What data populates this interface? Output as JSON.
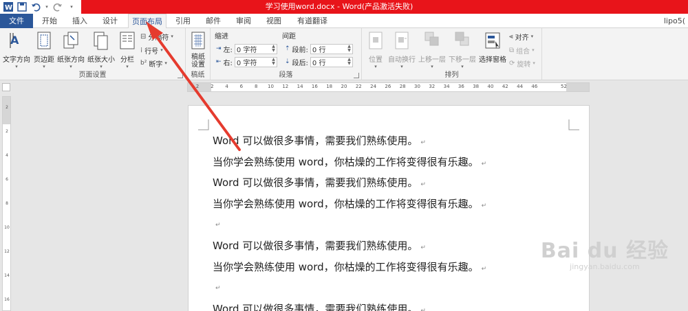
{
  "window": {
    "title": "学习使用word.docx -  Word(产品激活失败)"
  },
  "tabs": [
    {
      "label": "文件"
    },
    {
      "label": "开始"
    },
    {
      "label": "插入"
    },
    {
      "label": "设计"
    },
    {
      "label": "页面布局"
    },
    {
      "label": "引用"
    },
    {
      "label": "邮件"
    },
    {
      "label": "审阅"
    },
    {
      "label": "视图"
    },
    {
      "label": "有道翻译"
    }
  ],
  "account": {
    "name": "lipo5("
  },
  "page_setup": {
    "text_direction": "文字方向",
    "margins": "页边距",
    "orientation": "纸张方向",
    "size": "纸张大小",
    "columns": "分栏",
    "breaks": "分隔符",
    "line_numbers": "行号",
    "hyphenation": "断字",
    "group_label": "页面设置"
  },
  "draft_paper": {
    "button": "稿纸设置",
    "group_label": "稿纸"
  },
  "paragraph": {
    "indent_header": "缩进",
    "spacing_header": "间距",
    "left_label": "左:",
    "left_value": "0 字符",
    "right_label": "右:",
    "right_value": "0 字符",
    "before_label": "段前:",
    "before_value": "0 行",
    "after_label": "段后:",
    "after_value": "0 行",
    "group_label": "段落"
  },
  "arrange": {
    "position": "位置",
    "wrap_text": "自动换行",
    "bring_forward": "上移一层",
    "send_backward": "下移一层",
    "selection_pane": "选择窗格",
    "align": "对齐",
    "group": "组合",
    "rotate": "旋转",
    "group_label": "排列"
  },
  "ruler": {
    "ticks": [
      "2",
      "2",
      "4",
      "6",
      "8",
      "10",
      "12",
      "14",
      "16",
      "18",
      "20",
      "22",
      "24",
      "26",
      "28",
      "30",
      "32",
      "34",
      "36",
      "38",
      "40",
      "42",
      "44",
      "46",
      "",
      "52"
    ],
    "vticks": [
      "2",
      "",
      "2",
      "",
      "4",
      "",
      "6",
      "",
      "8",
      "",
      "10",
      "",
      "12",
      "",
      "14",
      "",
      "16"
    ]
  },
  "document": {
    "lines": [
      {
        "text": "Word 可以做很多事情，需要我们熟练使用。",
        "mark": "↵"
      },
      {
        "text": "当你学会熟练使用 word，你枯燥的工作将变得很有乐趣。",
        "mark": "↵"
      },
      {
        "text": "Word 可以做很多事情，需要我们熟练使用。",
        "mark": "↵"
      },
      {
        "text": "当你学会熟练使用 word，你枯燥的工作将变得很有乐趣。",
        "mark": "↵"
      },
      {
        "text": "",
        "mark": "↵"
      },
      {
        "text": "Word 可以做很多事情，需要我们熟练使用。",
        "mark": "↵"
      },
      {
        "text": "当你学会熟练使用 word，你枯燥的工作将变得很有乐趣。",
        "mark": "↵"
      },
      {
        "text": "",
        "mark": "↵"
      },
      {
        "text": "Word 可以做很多事情，需要我们熟练使用。",
        "mark": "↵"
      }
    ]
  },
  "watermark": {
    "brand": "Bai du 经验",
    "url": "jingyan.baidu.com"
  },
  "colors": {
    "title_bar": "#e8141a",
    "file_tab": "#2b579a",
    "annotation_arrow": "#e53b2e"
  }
}
